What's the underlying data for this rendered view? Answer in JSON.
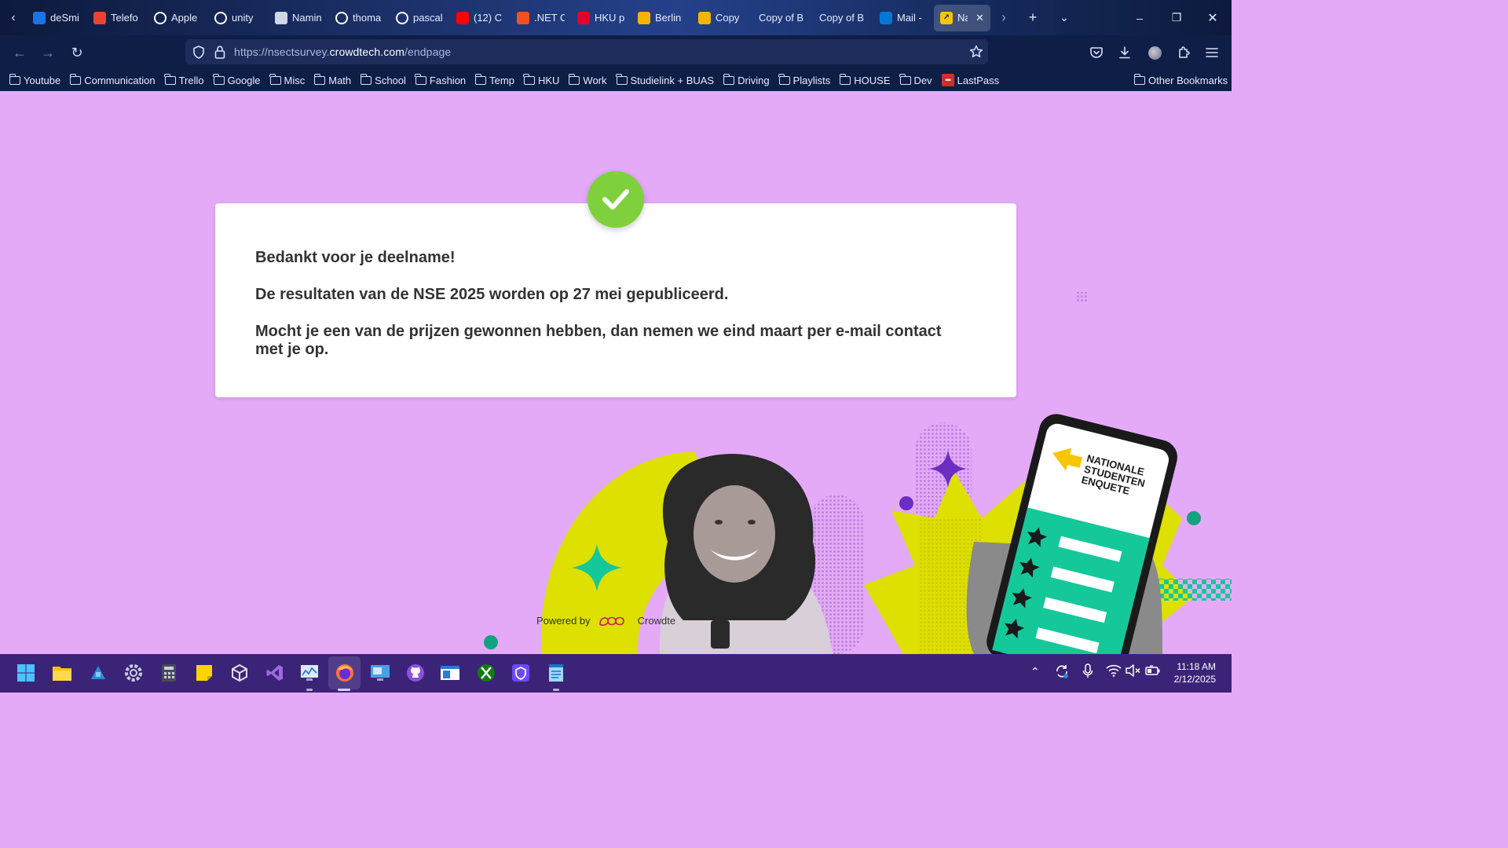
{
  "browser": {
    "tabs": [
      {
        "label": "deSmi",
        "icon": "calendar-icon",
        "color": "#1a73e8"
      },
      {
        "label": "Telefo",
        "icon": "gmail-icon",
        "color": "#ea4335"
      },
      {
        "label": "Apple",
        "icon": "github-icon",
        "color": "#ffffff"
      },
      {
        "label": "unity",
        "icon": "google-icon",
        "color": "#ffffff"
      },
      {
        "label": "Namin",
        "icon": "unity-icon",
        "color": "#cfd6e6"
      },
      {
        "label": "thoma",
        "icon": "github-icon",
        "color": "#ffffff"
      },
      {
        "label": "pascal",
        "icon": "google-icon",
        "color": "#ffffff"
      },
      {
        "label": "(12) C",
        "icon": "youtube-icon",
        "color": "#ff0000"
      },
      {
        "label": ".NET C",
        "icon": "microsoft-icon",
        "color": "#f25022"
      },
      {
        "label": "HKU p",
        "icon": "hku-icon",
        "color": "#e4002b"
      },
      {
        "label": "Berlin",
        "icon": "slides-icon",
        "color": "#f4b400"
      },
      {
        "label": "Copy",
        "icon": "slides-icon",
        "color": "#f4b400"
      },
      {
        "label": "Copy of B",
        "icon": "",
        "color": ""
      },
      {
        "label": "Copy of B",
        "icon": "",
        "color": ""
      },
      {
        "label": "Mail -",
        "icon": "outlook-icon",
        "color": "#0078d4"
      }
    ],
    "active_tab": {
      "label": "Nat",
      "icon": "nse-icon",
      "color": "#f7c600"
    },
    "url_prefix": "https://nsectsurvey.",
    "url_host": "crowdtech.com",
    "url_path": "/endpage",
    "bookmarks": [
      "Youtube",
      "Communication",
      "Trello",
      "Google",
      "Misc",
      "Math",
      "School",
      "Fashion",
      "Temp",
      "HKU",
      "Work",
      "Studielink + BUAS",
      "Driving",
      "Playlists",
      "HOUSE",
      "Dev"
    ],
    "lastpass_label": "LastPass",
    "other_bookmarks": "Other Bookmarks"
  },
  "page": {
    "thank_you": "Bedankt voor je deelname!",
    "results": "De resultaten van de NSE 2025 worden op 27 mei gepubliceerd.",
    "prizes": "Mocht je een van de prijzen gewonnen hebben, dan nemen we eind maart per e-mail contact met je op.",
    "powered_by": "Powered by",
    "powered_brand": "Crowdte",
    "phone_brand_lines": [
      "NATIONALE",
      "STUDENTEN",
      "ENQUETE"
    ],
    "accent_colors": {
      "background": "#e4aaf7",
      "check": "#7ed13c",
      "yellow": "#dde000",
      "teal": "#14c89a",
      "purple": "#6b2ec2"
    }
  },
  "taskbar": {
    "apps": [
      "windows-start-icon",
      "file-explorer-icon",
      "azure-data-icon",
      "settings-icon",
      "calculator-icon",
      "sticky-notes-icon",
      "unity-hub-icon",
      "visual-studio-icon",
      "resource-monitor-icon",
      "firefox-icon",
      "remote-desktop-icon",
      "github-desktop-icon",
      "window-app-icon",
      "xbox-icon",
      "proton-vpn-icon",
      "notepad-icon"
    ],
    "time": "11:18 AM",
    "date": "2/12/2025"
  }
}
